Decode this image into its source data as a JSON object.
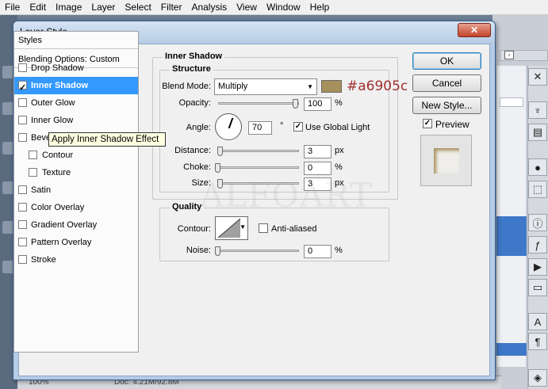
{
  "menubar": [
    "File",
    "Edit",
    "Image",
    "Layer",
    "Select",
    "Filter",
    "Analysis",
    "View",
    "Window",
    "Help"
  ],
  "dialog": {
    "title": "Layer Style",
    "close_glyph": "✕"
  },
  "styles_panel": {
    "header": "Styles",
    "blending": "Blending Options: Custom",
    "items": [
      {
        "label": "Drop Shadow",
        "checked": false,
        "selected": false,
        "indent": false
      },
      {
        "label": "Inner Shadow",
        "checked": true,
        "selected": true,
        "indent": false
      },
      {
        "label": "Outer Glow",
        "checked": false,
        "selected": false,
        "indent": false
      },
      {
        "label": "Inner Glow",
        "checked": false,
        "selected": false,
        "indent": false
      },
      {
        "label": "Bevel and Emboss",
        "checked": false,
        "selected": false,
        "indent": false
      },
      {
        "label": "Contour",
        "checked": false,
        "selected": false,
        "indent": true
      },
      {
        "label": "Texture",
        "checked": false,
        "selected": false,
        "indent": true
      },
      {
        "label": "Satin",
        "checked": false,
        "selected": false,
        "indent": false
      },
      {
        "label": "Color Overlay",
        "checked": false,
        "selected": false,
        "indent": false
      },
      {
        "label": "Gradient Overlay",
        "checked": false,
        "selected": false,
        "indent": false
      },
      {
        "label": "Pattern Overlay",
        "checked": false,
        "selected": false,
        "indent": false
      },
      {
        "label": "Stroke",
        "checked": false,
        "selected": false,
        "indent": false
      }
    ]
  },
  "tooltip": "Apply Inner Shadow Effect",
  "inner_shadow": {
    "title": "Inner Shadow",
    "structure": {
      "title": "Structure",
      "blend_mode_label": "Blend Mode:",
      "blend_mode": "Multiply",
      "color_hex": "#a6905c",
      "color_text": "#a6905c",
      "opacity_label": "Opacity:",
      "opacity": "100",
      "opacity_unit": "%",
      "angle_label": "Angle:",
      "angle": "70",
      "angle_unit": "°",
      "global_light_label": "Use Global Light",
      "distance_label": "Distance:",
      "distance": "3",
      "distance_unit": "px",
      "choke_label": "Choke:",
      "choke": "0",
      "choke_unit": "%",
      "size_label": "Size:",
      "size": "3",
      "size_unit": "px"
    },
    "quality": {
      "title": "Quality",
      "contour_label": "Contour:",
      "anti_aliased_label": "Anti-aliased",
      "noise_label": "Noise:",
      "noise": "0",
      "noise_unit": "%"
    }
  },
  "buttons": {
    "ok": "OK",
    "cancel": "Cancel",
    "new_style": "New Style...",
    "preview": "Preview"
  },
  "status": {
    "zoom": "100%",
    "doc": "Doc: 4.21M/92.8M"
  },
  "watermark": "ALFOART"
}
